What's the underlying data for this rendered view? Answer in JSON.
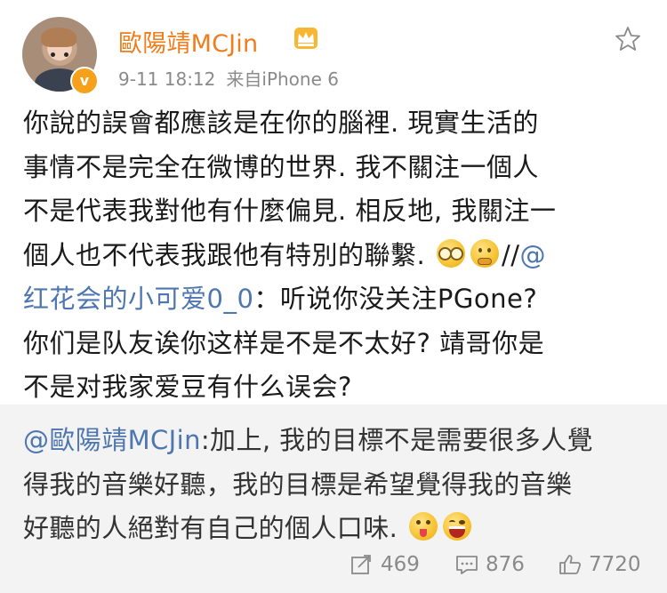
{
  "post": {
    "username": "歐陽靖MCJin",
    "time": "9-11 18:12",
    "source": "来自iPhone 6",
    "verified_badge": "v",
    "line1": "你說的誤會都應該是在你的腦裡. 現實生活的",
    "line2": "事情不是完全在微博的世界. 我不關注一個人",
    "line3": "不是代表我對他有什麼偏見. 相反地, 我關注一",
    "line4_text": "個人也不代表我跟他有特別的聯繫.",
    "line4_sep": "//",
    "mention_at": "@",
    "mention_name": "红花会的小可爱0_0",
    "quote_rest_line5": "：听说你没关注PGone?",
    "line6": "你们是队友诶你这样是不是不太好? 靖哥你是",
    "line7": "不是对我家爱豆有什么误会?"
  },
  "repost": {
    "mention": "@歐陽靖MCJin",
    "line1_rest": ":加上, 我的目標不是需要很多人覺",
    "line2": "得我的音樂好聽，我的目標是希望覺得我的音樂",
    "line3": "好聽的人絕對有自己的個人口味."
  },
  "actions": {
    "repost_count": "469",
    "comment_count": "876",
    "like_count": "7720"
  },
  "icons": [
    "star-icon",
    "crown-icon",
    "repost-icon",
    "comment-icon",
    "like-icon",
    "verified-badge-icon"
  ],
  "colors": {
    "username": "#f07d1b",
    "link": "#4e76b0",
    "meta": "#8a8a8a",
    "repost_bg": "#f3f3f3"
  }
}
